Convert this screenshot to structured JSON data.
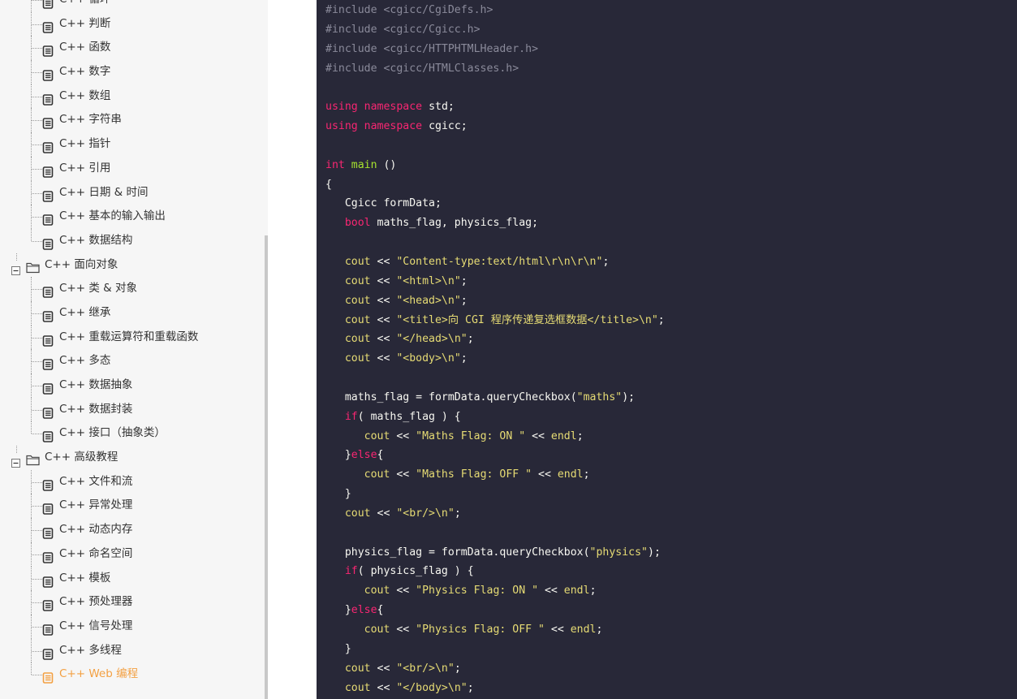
{
  "sidebar": {
    "items": [
      {
        "label": "C++ 循环",
        "type": "leaf"
      },
      {
        "label": "C++ 判断",
        "type": "leaf"
      },
      {
        "label": "C++ 函数",
        "type": "leaf"
      },
      {
        "label": "C++ 数字",
        "type": "leaf"
      },
      {
        "label": "C++ 数组",
        "type": "leaf"
      },
      {
        "label": "C++ 字符串",
        "type": "leaf"
      },
      {
        "label": "C++ 指针",
        "type": "leaf"
      },
      {
        "label": "C++ 引用",
        "type": "leaf"
      },
      {
        "label": "C++ 日期 & 时间",
        "type": "leaf"
      },
      {
        "label": "C++ 基本的输入输出",
        "type": "leaf"
      },
      {
        "label": "C++ 数据结构",
        "type": "leaf"
      },
      {
        "label": "C++ 面向对象",
        "type": "folder"
      },
      {
        "label": "C++ 类 & 对象",
        "type": "leaf"
      },
      {
        "label": "C++ 继承",
        "type": "leaf"
      },
      {
        "label": "C++ 重载运算符和重载函数",
        "type": "leaf"
      },
      {
        "label": "C++ 多态",
        "type": "leaf"
      },
      {
        "label": "C++ 数据抽象",
        "type": "leaf"
      },
      {
        "label": "C++ 数据封装",
        "type": "leaf"
      },
      {
        "label": "C++ 接口（抽象类）",
        "type": "leaf"
      },
      {
        "label": "C++ 高级教程",
        "type": "folder"
      },
      {
        "label": "C++ 文件和流",
        "type": "leaf"
      },
      {
        "label": "C++ 异常处理",
        "type": "leaf"
      },
      {
        "label": "C++ 动态内存",
        "type": "leaf"
      },
      {
        "label": "C++ 命名空间",
        "type": "leaf"
      },
      {
        "label": "C++ 模板",
        "type": "leaf"
      },
      {
        "label": "C++ 预处理器",
        "type": "leaf"
      },
      {
        "label": "C++ 信号处理",
        "type": "leaf"
      },
      {
        "label": "C++ 多线程",
        "type": "leaf"
      },
      {
        "label": "C++ Web 编程",
        "type": "leaf",
        "active": true
      }
    ],
    "active_color": "#f3a042"
  },
  "code": {
    "lines": [
      [
        [
          "preproc",
          "#include <cgicc/CgiDefs.h>"
        ]
      ],
      [
        [
          "preproc",
          "#include <cgicc/Cgicc.h>"
        ]
      ],
      [
        [
          "preproc",
          "#include <cgicc/HTTPHTMLHeader.h>"
        ]
      ],
      [
        [
          "preproc",
          "#include <cgicc/HTMLClasses.h>"
        ]
      ],
      [],
      [
        [
          "keyword",
          "using"
        ],
        [
          "plain",
          " "
        ],
        [
          "keyword",
          "namespace"
        ],
        [
          "plain",
          " std;"
        ]
      ],
      [
        [
          "keyword",
          "using"
        ],
        [
          "plain",
          " "
        ],
        [
          "keyword",
          "namespace"
        ],
        [
          "plain",
          " cgicc;"
        ]
      ],
      [],
      [
        [
          "keyword",
          "int"
        ],
        [
          "plain",
          " "
        ],
        [
          "function",
          "main"
        ],
        [
          "plain",
          " ()"
        ]
      ],
      [
        [
          "plain",
          "{"
        ]
      ],
      [
        [
          "plain",
          "   Cgicc formData;"
        ]
      ],
      [
        [
          "plain",
          "   "
        ],
        [
          "keyword",
          "bool"
        ],
        [
          "plain",
          " maths_flag, physics_flag;"
        ]
      ],
      [],
      [
        [
          "plain",
          "   "
        ],
        [
          "builtin",
          "cout"
        ],
        [
          "plain",
          " << "
        ],
        [
          "string",
          "\"Content-type:text/html\\r\\n\\r\\n\""
        ],
        [
          "plain",
          ";"
        ]
      ],
      [
        [
          "plain",
          "   "
        ],
        [
          "builtin",
          "cout"
        ],
        [
          "plain",
          " << "
        ],
        [
          "string",
          "\"<html>\\n\""
        ],
        [
          "plain",
          ";"
        ]
      ],
      [
        [
          "plain",
          "   "
        ],
        [
          "builtin",
          "cout"
        ],
        [
          "plain",
          " << "
        ],
        [
          "string",
          "\"<head>\\n\""
        ],
        [
          "plain",
          ";"
        ]
      ],
      [
        [
          "plain",
          "   "
        ],
        [
          "builtin",
          "cout"
        ],
        [
          "plain",
          " << "
        ],
        [
          "string",
          "\"<title>向 CGI 程序传递复选框数据</title>\\n\""
        ],
        [
          "plain",
          ";"
        ]
      ],
      [
        [
          "plain",
          "   "
        ],
        [
          "builtin",
          "cout"
        ],
        [
          "plain",
          " << "
        ],
        [
          "string",
          "\"</head>\\n\""
        ],
        [
          "plain",
          ";"
        ]
      ],
      [
        [
          "plain",
          "   "
        ],
        [
          "builtin",
          "cout"
        ],
        [
          "plain",
          " << "
        ],
        [
          "string",
          "\"<body>\\n\""
        ],
        [
          "plain",
          ";"
        ]
      ],
      [],
      [
        [
          "plain",
          "   maths_flag = formData.queryCheckbox("
        ],
        [
          "string",
          "\"maths\""
        ],
        [
          "plain",
          ");"
        ]
      ],
      [
        [
          "plain",
          "   "
        ],
        [
          "keyword",
          "if"
        ],
        [
          "plain",
          "( maths_flag ) {"
        ]
      ],
      [
        [
          "plain",
          "      "
        ],
        [
          "builtin",
          "cout"
        ],
        [
          "plain",
          " << "
        ],
        [
          "string",
          "\"Maths Flag: ON \""
        ],
        [
          "plain",
          " << "
        ],
        [
          "builtin",
          "endl"
        ],
        [
          "plain",
          ";"
        ]
      ],
      [
        [
          "plain",
          "   }"
        ],
        [
          "keyword",
          "else"
        ],
        [
          "plain",
          "{"
        ]
      ],
      [
        [
          "plain",
          "      "
        ],
        [
          "builtin",
          "cout"
        ],
        [
          "plain",
          " << "
        ],
        [
          "string",
          "\"Maths Flag: OFF \""
        ],
        [
          "plain",
          " << "
        ],
        [
          "builtin",
          "endl"
        ],
        [
          "plain",
          ";"
        ]
      ],
      [
        [
          "plain",
          "   }"
        ]
      ],
      [
        [
          "plain",
          "   "
        ],
        [
          "builtin",
          "cout"
        ],
        [
          "plain",
          " << "
        ],
        [
          "string",
          "\"<br/>\\n\""
        ],
        [
          "plain",
          ";"
        ]
      ],
      [],
      [
        [
          "plain",
          "   physics_flag = formData.queryCheckbox("
        ],
        [
          "string",
          "\"physics\""
        ],
        [
          "plain",
          ");"
        ]
      ],
      [
        [
          "plain",
          "   "
        ],
        [
          "keyword",
          "if"
        ],
        [
          "plain",
          "( physics_flag ) {"
        ]
      ],
      [
        [
          "plain",
          "      "
        ],
        [
          "builtin",
          "cout"
        ],
        [
          "plain",
          " << "
        ],
        [
          "string",
          "\"Physics Flag: ON \""
        ],
        [
          "plain",
          " << "
        ],
        [
          "builtin",
          "endl"
        ],
        [
          "plain",
          ";"
        ]
      ],
      [
        [
          "plain",
          "   }"
        ],
        [
          "keyword",
          "else"
        ],
        [
          "plain",
          "{"
        ]
      ],
      [
        [
          "plain",
          "      "
        ],
        [
          "builtin",
          "cout"
        ],
        [
          "plain",
          " << "
        ],
        [
          "string",
          "\"Physics Flag: OFF \""
        ],
        [
          "plain",
          " << "
        ],
        [
          "builtin",
          "endl"
        ],
        [
          "plain",
          ";"
        ]
      ],
      [
        [
          "plain",
          "   }"
        ]
      ],
      [
        [
          "plain",
          "   "
        ],
        [
          "builtin",
          "cout"
        ],
        [
          "plain",
          " << "
        ],
        [
          "string",
          "\"<br/>\\n\""
        ],
        [
          "plain",
          ";"
        ]
      ],
      [
        [
          "plain",
          "   "
        ],
        [
          "builtin",
          "cout"
        ],
        [
          "plain",
          " << "
        ],
        [
          "string",
          "\"</body>\\n\""
        ],
        [
          "plain",
          ";"
        ]
      ]
    ]
  }
}
